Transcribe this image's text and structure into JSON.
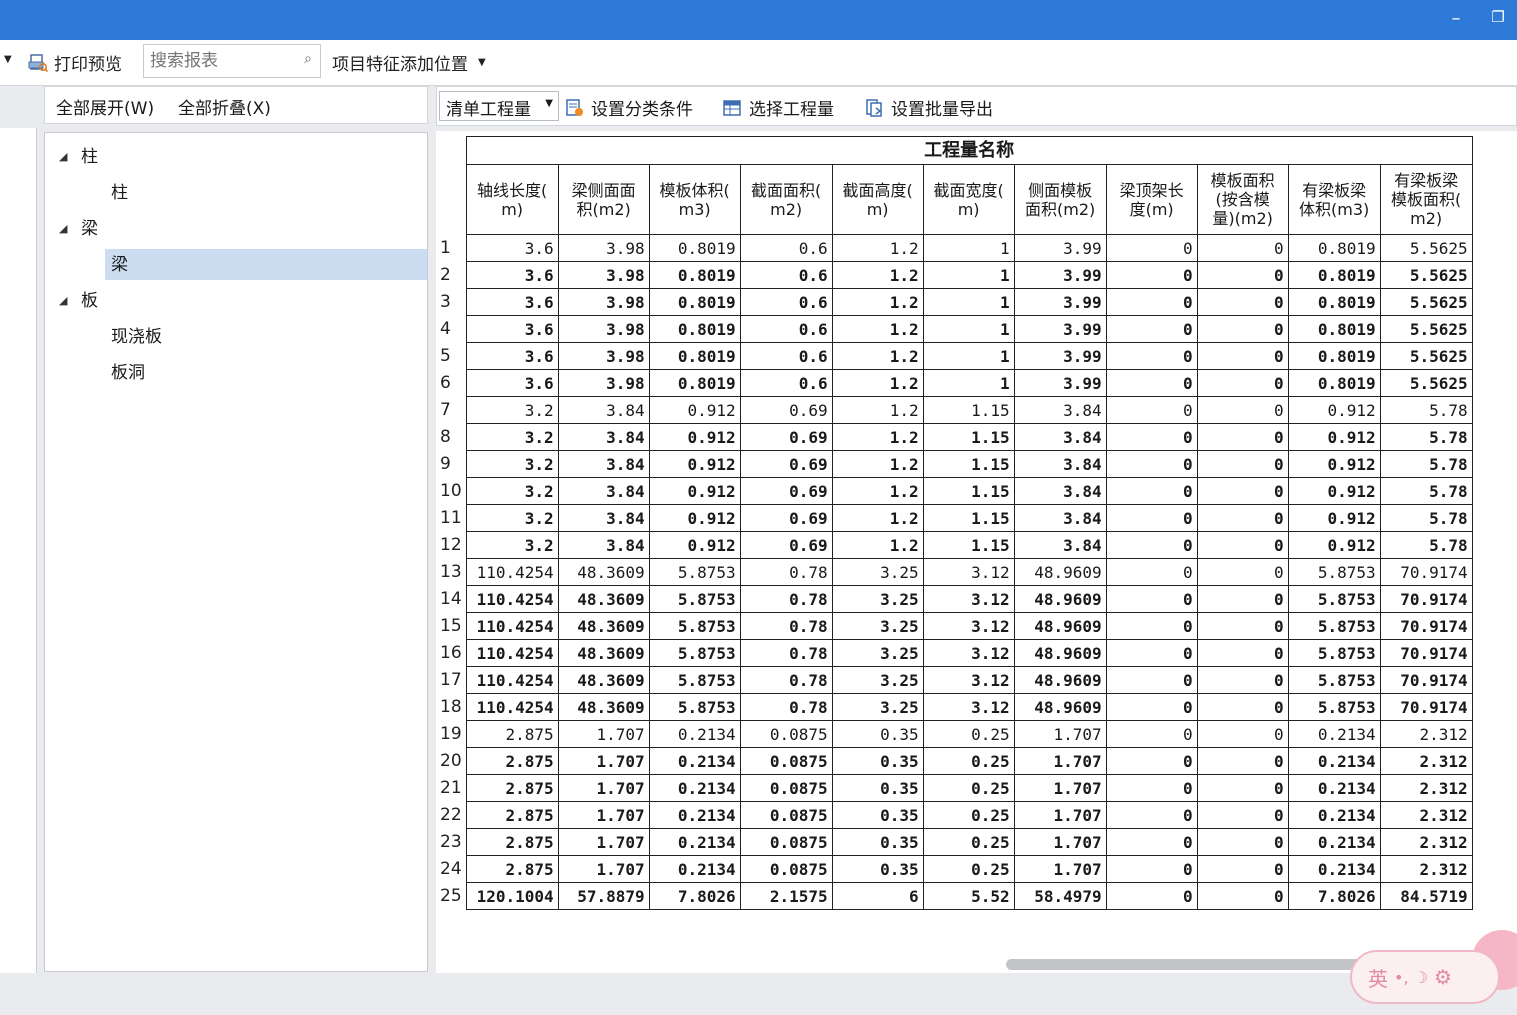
{
  "window": {
    "minimize_glyph": "–",
    "restore_glyph": "❐"
  },
  "toolbar": {
    "print_preview_label": "打印预览",
    "search_placeholder": "搜索报表",
    "feature_position_label": "项目特征添加位置"
  },
  "tree_toolbar": {
    "expand_all": "全部展开(W)",
    "collapse_all": "全部折叠(X)"
  },
  "tree": [
    {
      "label": "柱",
      "children": [
        "柱"
      ]
    },
    {
      "label": "梁",
      "children": [
        "梁"
      ]
    },
    {
      "label": "板",
      "children": [
        "现浇板",
        "板洞"
      ]
    }
  ],
  "right_toolbar": {
    "quantity_combo": "清单工程量",
    "set_category": "设置分类条件",
    "select_quantity": "选择工程量",
    "batch_export": "设置批量导出"
  },
  "table": {
    "group_header": "工程量名称",
    "columns": [
      "轴线长度(\nm)",
      "梁侧面面\n积(m2)",
      "模板体积(\nm3)",
      "截面面积(\nm2)",
      "截面高度(\nm)",
      "截面宽度(\nm)",
      "侧面模板\n面积(m2)",
      "梁顶架长\n度(m)",
      "模板面积\n(按含模\n量)(m2)",
      "有梁板梁\n体积(m3)",
      "有梁板梁\n模板面积(\nm2)"
    ],
    "rows": [
      {
        "n": "1",
        "bold": false,
        "v": [
          "3.6",
          "3.98",
          "0.8019",
          "0.6",
          "1.2",
          "1",
          "3.99",
          "0",
          "0",
          "0.8019",
          "5.5625"
        ]
      },
      {
        "n": "2",
        "bold": true,
        "v": [
          "3.6",
          "3.98",
          "0.8019",
          "0.6",
          "1.2",
          "1",
          "3.99",
          "0",
          "0",
          "0.8019",
          "5.5625"
        ]
      },
      {
        "n": "3",
        "bold": true,
        "v": [
          "3.6",
          "3.98",
          "0.8019",
          "0.6",
          "1.2",
          "1",
          "3.99",
          "0",
          "0",
          "0.8019",
          "5.5625"
        ]
      },
      {
        "n": "4",
        "bold": true,
        "v": [
          "3.6",
          "3.98",
          "0.8019",
          "0.6",
          "1.2",
          "1",
          "3.99",
          "0",
          "0",
          "0.8019",
          "5.5625"
        ]
      },
      {
        "n": "5",
        "bold": true,
        "v": [
          "3.6",
          "3.98",
          "0.8019",
          "0.6",
          "1.2",
          "1",
          "3.99",
          "0",
          "0",
          "0.8019",
          "5.5625"
        ]
      },
      {
        "n": "6",
        "bold": true,
        "v": [
          "3.6",
          "3.98",
          "0.8019",
          "0.6",
          "1.2",
          "1",
          "3.99",
          "0",
          "0",
          "0.8019",
          "5.5625"
        ]
      },
      {
        "n": "7",
        "bold": false,
        "v": [
          "3.2",
          "3.84",
          "0.912",
          "0.69",
          "1.2",
          "1.15",
          "3.84",
          "0",
          "0",
          "0.912",
          "5.78"
        ]
      },
      {
        "n": "8",
        "bold": true,
        "v": [
          "3.2",
          "3.84",
          "0.912",
          "0.69",
          "1.2",
          "1.15",
          "3.84",
          "0",
          "0",
          "0.912",
          "5.78"
        ]
      },
      {
        "n": "9",
        "bold": true,
        "v": [
          "3.2",
          "3.84",
          "0.912",
          "0.69",
          "1.2",
          "1.15",
          "3.84",
          "0",
          "0",
          "0.912",
          "5.78"
        ]
      },
      {
        "n": "10",
        "bold": true,
        "v": [
          "3.2",
          "3.84",
          "0.912",
          "0.69",
          "1.2",
          "1.15",
          "3.84",
          "0",
          "0",
          "0.912",
          "5.78"
        ]
      },
      {
        "n": "11",
        "bold": true,
        "v": [
          "3.2",
          "3.84",
          "0.912",
          "0.69",
          "1.2",
          "1.15",
          "3.84",
          "0",
          "0",
          "0.912",
          "5.78"
        ]
      },
      {
        "n": "12",
        "bold": true,
        "v": [
          "3.2",
          "3.84",
          "0.912",
          "0.69",
          "1.2",
          "1.15",
          "3.84",
          "0",
          "0",
          "0.912",
          "5.78"
        ]
      },
      {
        "n": "13",
        "bold": false,
        "v": [
          "110.4254",
          "48.3609",
          "5.8753",
          "0.78",
          "3.25",
          "3.12",
          "48.9609",
          "0",
          "0",
          "5.8753",
          "70.9174"
        ]
      },
      {
        "n": "14",
        "bold": true,
        "v": [
          "110.4254",
          "48.3609",
          "5.8753",
          "0.78",
          "3.25",
          "3.12",
          "48.9609",
          "0",
          "0",
          "5.8753",
          "70.9174"
        ]
      },
      {
        "n": "15",
        "bold": true,
        "v": [
          "110.4254",
          "48.3609",
          "5.8753",
          "0.78",
          "3.25",
          "3.12",
          "48.9609",
          "0",
          "0",
          "5.8753",
          "70.9174"
        ]
      },
      {
        "n": "16",
        "bold": true,
        "v": [
          "110.4254",
          "48.3609",
          "5.8753",
          "0.78",
          "3.25",
          "3.12",
          "48.9609",
          "0",
          "0",
          "5.8753",
          "70.9174"
        ]
      },
      {
        "n": "17",
        "bold": true,
        "v": [
          "110.4254",
          "48.3609",
          "5.8753",
          "0.78",
          "3.25",
          "3.12",
          "48.9609",
          "0",
          "0",
          "5.8753",
          "70.9174"
        ]
      },
      {
        "n": "18",
        "bold": true,
        "v": [
          "110.4254",
          "48.3609",
          "5.8753",
          "0.78",
          "3.25",
          "3.12",
          "48.9609",
          "0",
          "0",
          "5.8753",
          "70.9174"
        ]
      },
      {
        "n": "19",
        "bold": false,
        "v": [
          "2.875",
          "1.707",
          "0.2134",
          "0.0875",
          "0.35",
          "0.25",
          "1.707",
          "0",
          "0",
          "0.2134",
          "2.312"
        ]
      },
      {
        "n": "20",
        "bold": true,
        "v": [
          "2.875",
          "1.707",
          "0.2134",
          "0.0875",
          "0.35",
          "0.25",
          "1.707",
          "0",
          "0",
          "0.2134",
          "2.312"
        ]
      },
      {
        "n": "21",
        "bold": true,
        "v": [
          "2.875",
          "1.707",
          "0.2134",
          "0.0875",
          "0.35",
          "0.25",
          "1.707",
          "0",
          "0",
          "0.2134",
          "2.312"
        ]
      },
      {
        "n": "22",
        "bold": true,
        "v": [
          "2.875",
          "1.707",
          "0.2134",
          "0.0875",
          "0.35",
          "0.25",
          "1.707",
          "0",
          "0",
          "0.2134",
          "2.312"
        ]
      },
      {
        "n": "23",
        "bold": true,
        "v": [
          "2.875",
          "1.707",
          "0.2134",
          "0.0875",
          "0.35",
          "0.25",
          "1.707",
          "0",
          "0",
          "0.2134",
          "2.312"
        ]
      },
      {
        "n": "24",
        "bold": true,
        "v": [
          "2.875",
          "1.707",
          "0.2134",
          "0.0875",
          "0.35",
          "0.25",
          "1.707",
          "0",
          "0",
          "0.2134",
          "2.312"
        ]
      },
      {
        "n": "25",
        "bold": true,
        "v": [
          "120.1004",
          "57.8879",
          "7.8026",
          "2.1575",
          "6",
          "5.52",
          "58.4979",
          "0",
          "0",
          "7.8026",
          "84.5719"
        ]
      }
    ]
  },
  "ime": {
    "label": "英",
    "symbols": "•, ☽"
  }
}
